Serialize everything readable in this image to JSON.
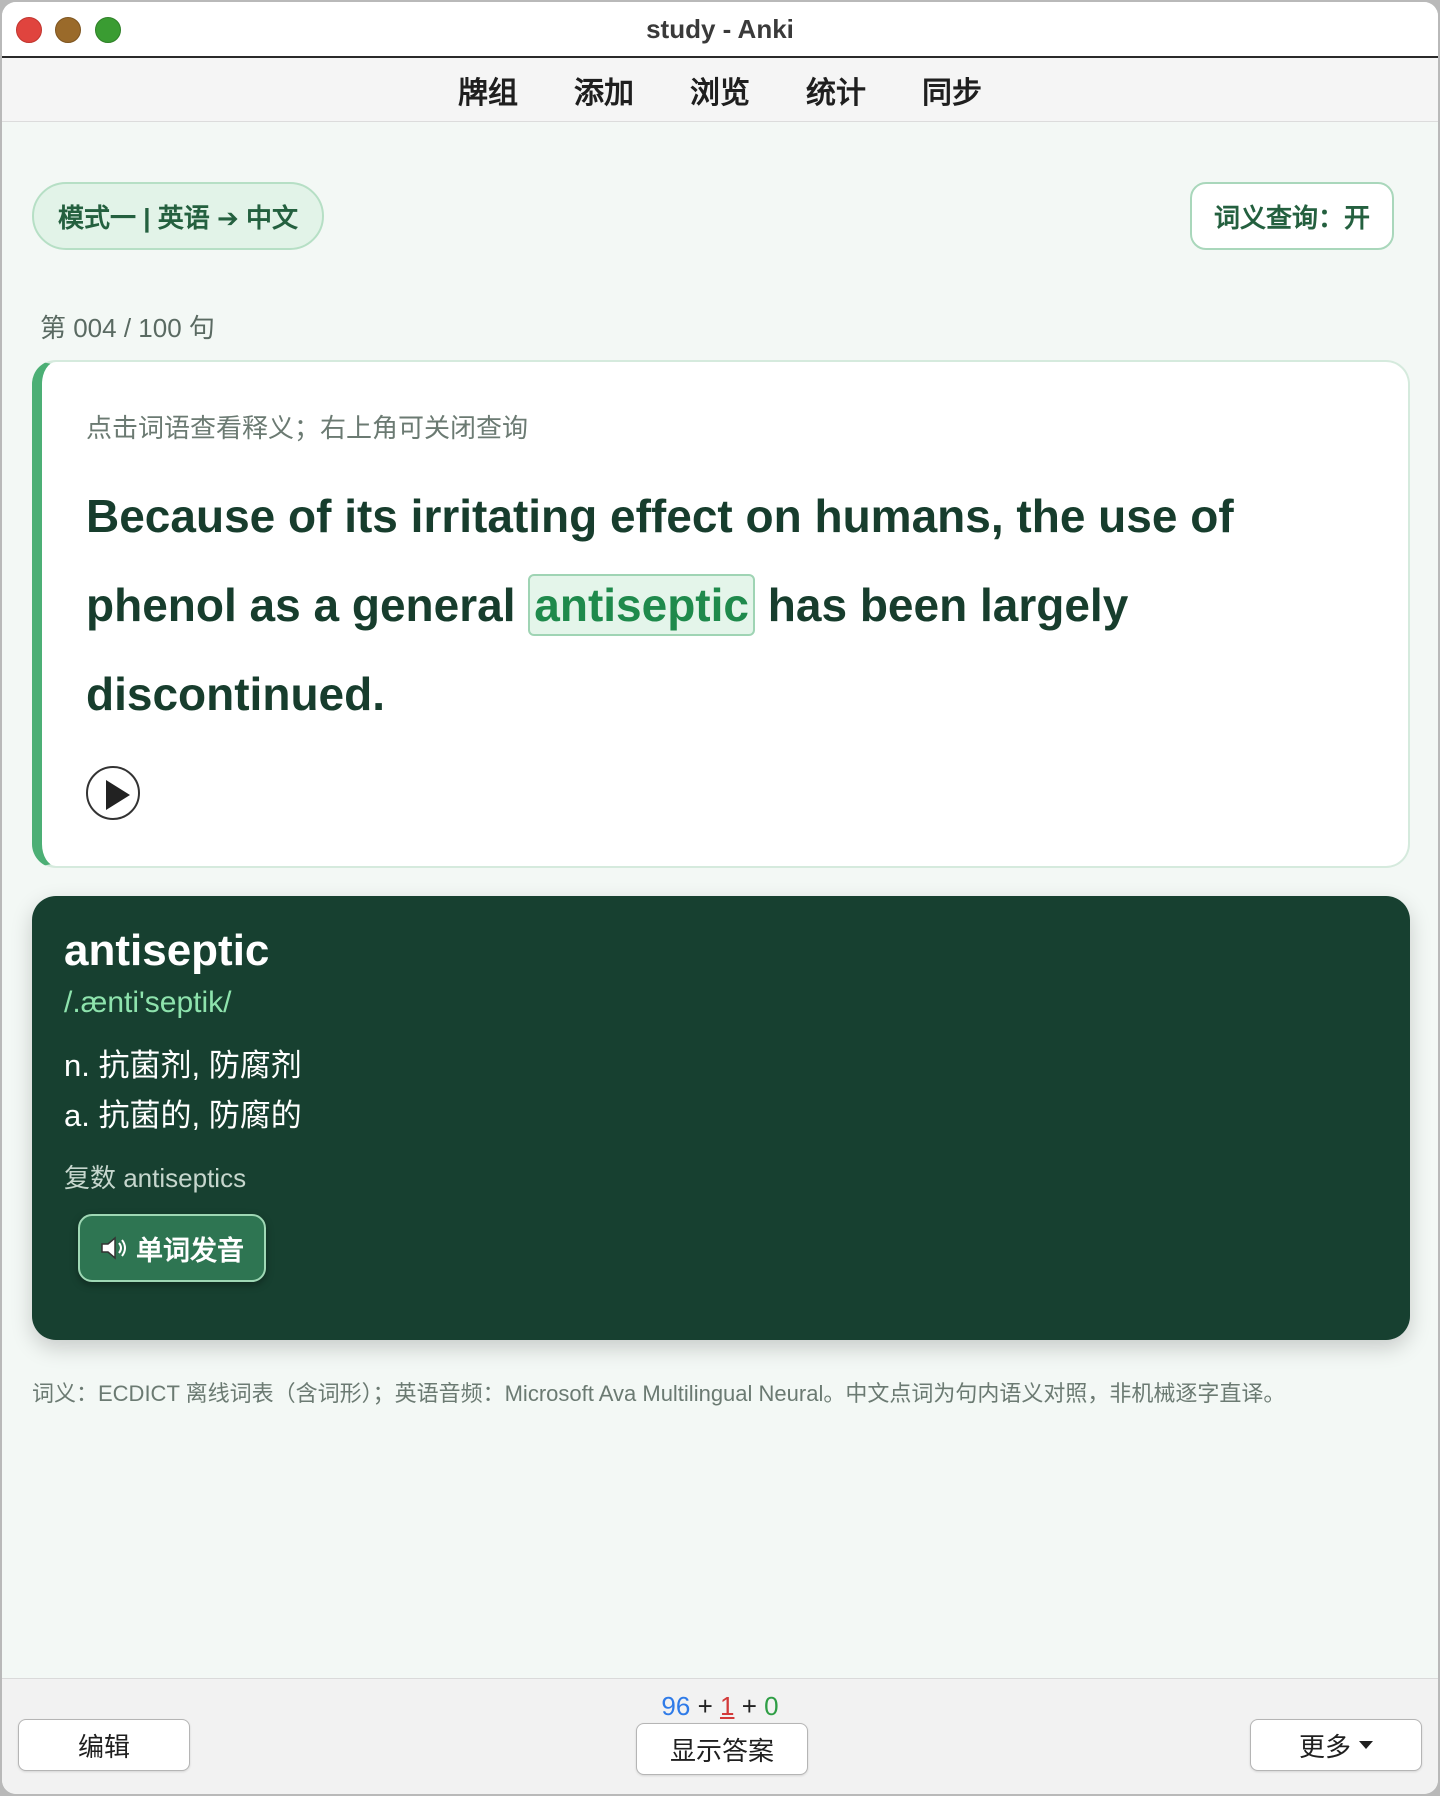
{
  "window": {
    "title": "study - Anki"
  },
  "menu": {
    "items": [
      "牌组",
      "添加",
      "浏览",
      "统计",
      "同步"
    ]
  },
  "mode_pill": "模式一 | 英语 ➔ 中文",
  "lookup_toggle": "词义查询：开",
  "progress": "第 004 / 100 句",
  "sentence_card": {
    "hint": "点击词语查看释义；右上角可关闭查询",
    "before": "Because of its irritating effect on humans, the use of phenol as a general ",
    "highlight": "antiseptic",
    "after": " has been largely discontinued."
  },
  "definition": {
    "word": "antiseptic",
    "phonetic": "/.ænti'septik/",
    "senses": [
      "n. 抗菌剂, 防腐剂",
      "a. 抗菌的, 防腐的"
    ],
    "plural": "复数 antiseptics",
    "pronounce_label": "单词发音",
    "pronounce_icon": "speaker-icon"
  },
  "footer_note": "词义：ECDICT 离线词表（含词形）；英语音频：Microsoft Ava Multilingual Neural。中文点词为句内语义对照，非机械逐字直译。",
  "counts": {
    "new": "96",
    "learning": "1",
    "review": "0",
    "sep": "+"
  },
  "bottom": {
    "edit": "编辑",
    "show_answer": "显示答案",
    "more": "更多"
  },
  "colors": {
    "accent": "#4caf75",
    "card_dark": "#174030",
    "phonetic": "#8ee3ad"
  }
}
